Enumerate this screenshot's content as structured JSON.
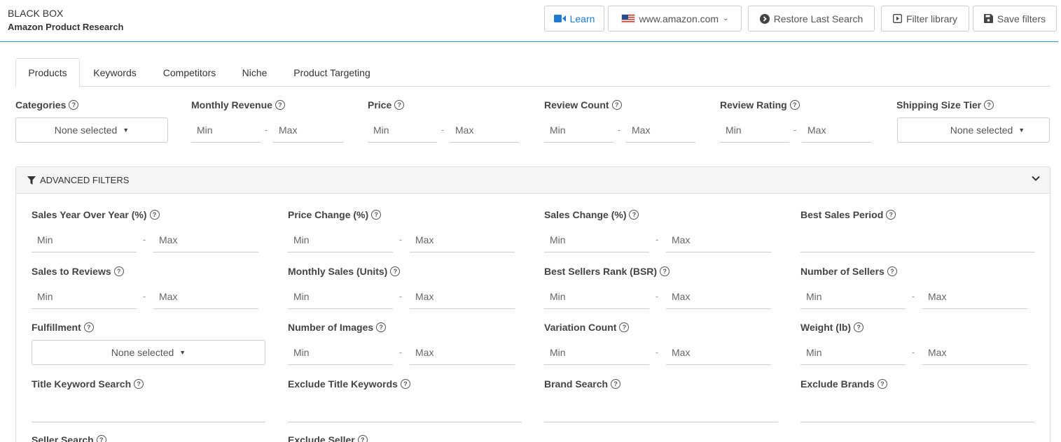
{
  "header": {
    "brand": "BLACK BOX",
    "subtitle": "Amazon Product Research",
    "learn": "Learn",
    "domain": "www.amazon.com",
    "restore": "Restore Last Search",
    "filter_library": "Filter library",
    "save_filters": "Save filters"
  },
  "tabs": [
    "Products",
    "Keywords",
    "Competitors",
    "Niche",
    "Product Targeting"
  ],
  "basic_filters": {
    "categories": "Categories",
    "categories_value": "None selected",
    "monthly_revenue": "Monthly Revenue",
    "price": "Price",
    "review_count": "Review Count",
    "review_rating": "Review Rating",
    "shipping_size_tier": "Shipping Size Tier",
    "shipping_value": "None selected"
  },
  "placeholders": {
    "min": "Min",
    "max": "Max",
    "dash": "-"
  },
  "advanced": {
    "title": "ADVANCED FILTERS",
    "sales_yoy": "Sales Year Over Year (%)",
    "price_change": "Price Change (%)",
    "sales_change": "Sales Change (%)",
    "best_sales_period": "Best Sales Period",
    "sales_to_reviews": "Sales to Reviews",
    "monthly_sales": "Monthly Sales (Units)",
    "bsr": "Best Sellers Rank (BSR)",
    "number_of_sellers": "Number of Sellers",
    "fulfillment": "Fulfillment",
    "fulfillment_value": "None selected",
    "number_of_images": "Number of Images",
    "variation_count": "Variation Count",
    "weight": "Weight (lb)",
    "title_keyword_search": "Title Keyword Search",
    "exclude_title_keywords": "Exclude Title Keywords",
    "brand_search": "Brand Search",
    "exclude_brands": "Exclude Brands",
    "seller_search": "Seller Search",
    "exclude_seller": "Exclude Seller"
  }
}
